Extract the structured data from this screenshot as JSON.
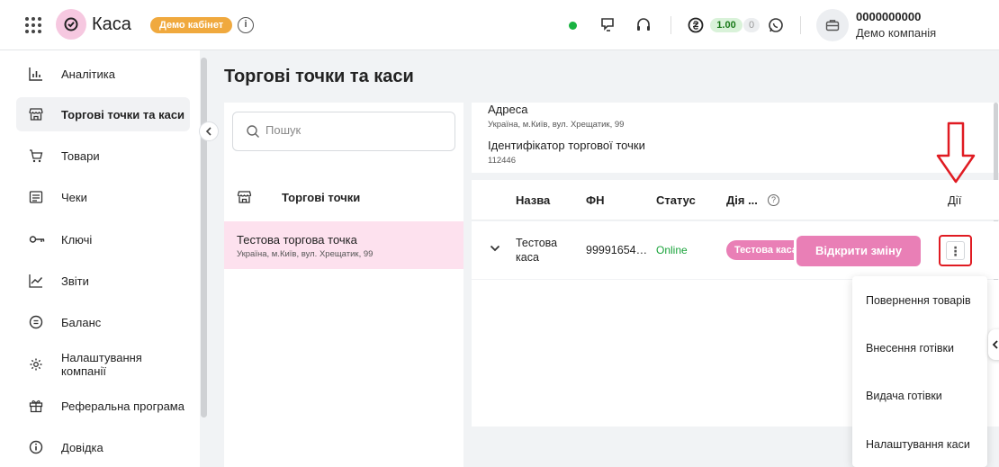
{
  "header": {
    "logo_text": "Каса",
    "demo_badge": "Демо кабінет",
    "info_glyph": "i",
    "balance_main": "1.00",
    "balance_secondary": "0",
    "company_id": "0000000000",
    "company_name": "Демо компанія",
    "icons": [
      "apps-grid-icon",
      "logo-check-icon",
      "info-icon",
      "online-status-dot",
      "chat-icon",
      "headset-icon",
      "hryvnia-icon",
      "whatsapp-icon",
      "briefcase-icon"
    ],
    "status_color": "#19b341"
  },
  "sidebar": {
    "items": [
      {
        "label": "Аналітика",
        "icon": "bar-chart-icon"
      },
      {
        "label": "Торгові точки та каси",
        "icon": "store-icon",
        "active": true
      },
      {
        "label": "Товари",
        "icon": "cart-icon"
      },
      {
        "label": "Чеки",
        "icon": "receipt-icon"
      },
      {
        "label": "Ключі",
        "icon": "key-icon"
      },
      {
        "label": "Звіти",
        "icon": "trend-chart-icon"
      },
      {
        "label": "Баланс",
        "icon": "hryvnia-coin-icon"
      },
      {
        "label": "Налаштування компанії",
        "icon": "gear-icon"
      },
      {
        "label": "Реферальна програма",
        "icon": "gift-icon"
      },
      {
        "label": "Довідка",
        "icon": "help-info-icon"
      }
    ]
  },
  "page": {
    "title": "Торгові точки та каси"
  },
  "left_panel": {
    "search_placeholder": "Пошук",
    "header": "Торгові точки",
    "shop": {
      "name": "Тестова торгова точка",
      "address": "Україна, м.Київ, вул. Хрещатик, 99"
    }
  },
  "details": {
    "address_label": "Адреса",
    "address_value": "Україна, м.Київ, вул. Хрещатик, 99",
    "id_label": "Ідентифікатор торгової точки",
    "id_value": "112446"
  },
  "table": {
    "headers": {
      "name": "Назва",
      "fn": "ФН",
      "status": "Статус",
      "action": "Дія ...",
      "help": "?",
      "actions": "Дії"
    },
    "row": {
      "name_line1": "Тестова",
      "name_line2": "каса",
      "fn": "99991654…",
      "status": "Online",
      "tag": "Тестова каса",
      "open_button": "Відкрити зміну",
      "kebab": "⋮"
    }
  },
  "dropdown": {
    "items": [
      "Повернення товарів",
      "Внесення готівки",
      "Видача готівки",
      "Налаштування каси"
    ]
  },
  "colors": {
    "accent_pink": "#e97fb6",
    "selected_row": "#fde1ee",
    "demo_badge": "#f0a93e",
    "highlight_red": "#e01b22"
  }
}
